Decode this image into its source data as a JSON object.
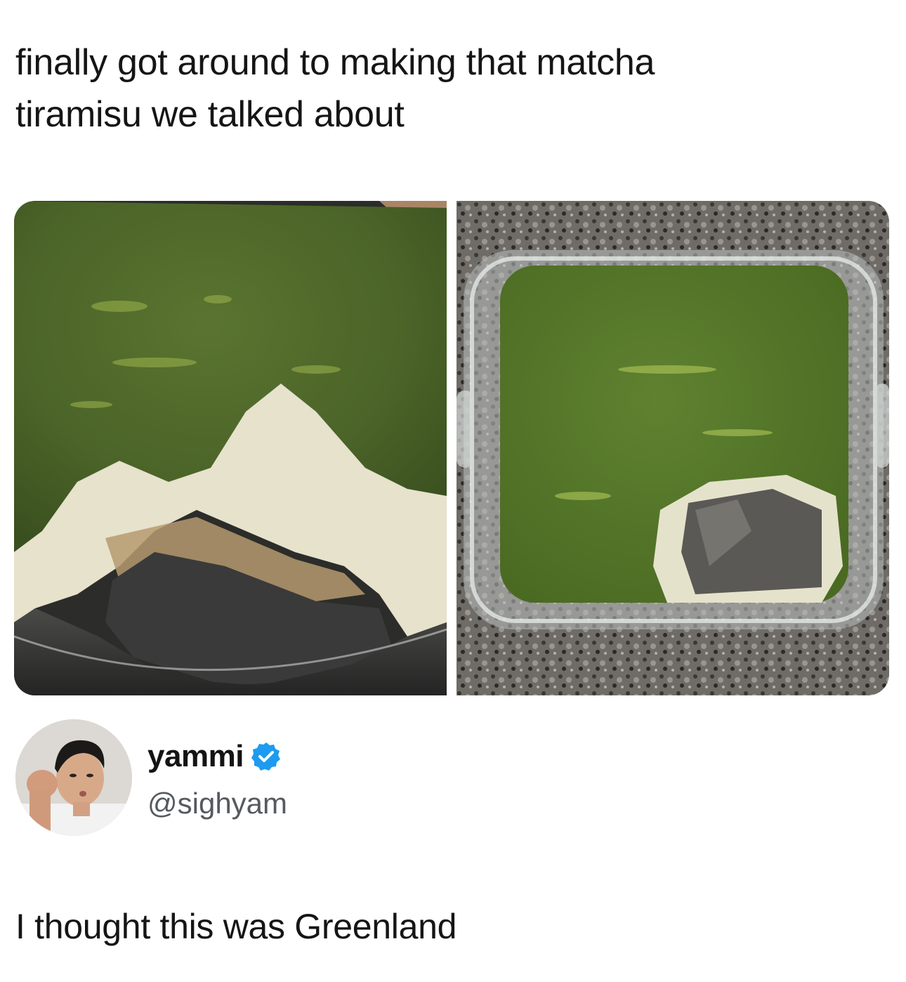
{
  "post": {
    "text_line1": "finally got around to making that matcha",
    "text_line2": "tiramisu we talked about"
  },
  "author": {
    "display_name": "yammi",
    "handle": "@sighyam",
    "verified_color": "#1d9bf0"
  },
  "caption": {
    "text": "I thought this was Greenland"
  },
  "colors": {
    "matcha": "#4d6b2a",
    "cream": "#e8e4d0",
    "granite": "#6a6762"
  }
}
